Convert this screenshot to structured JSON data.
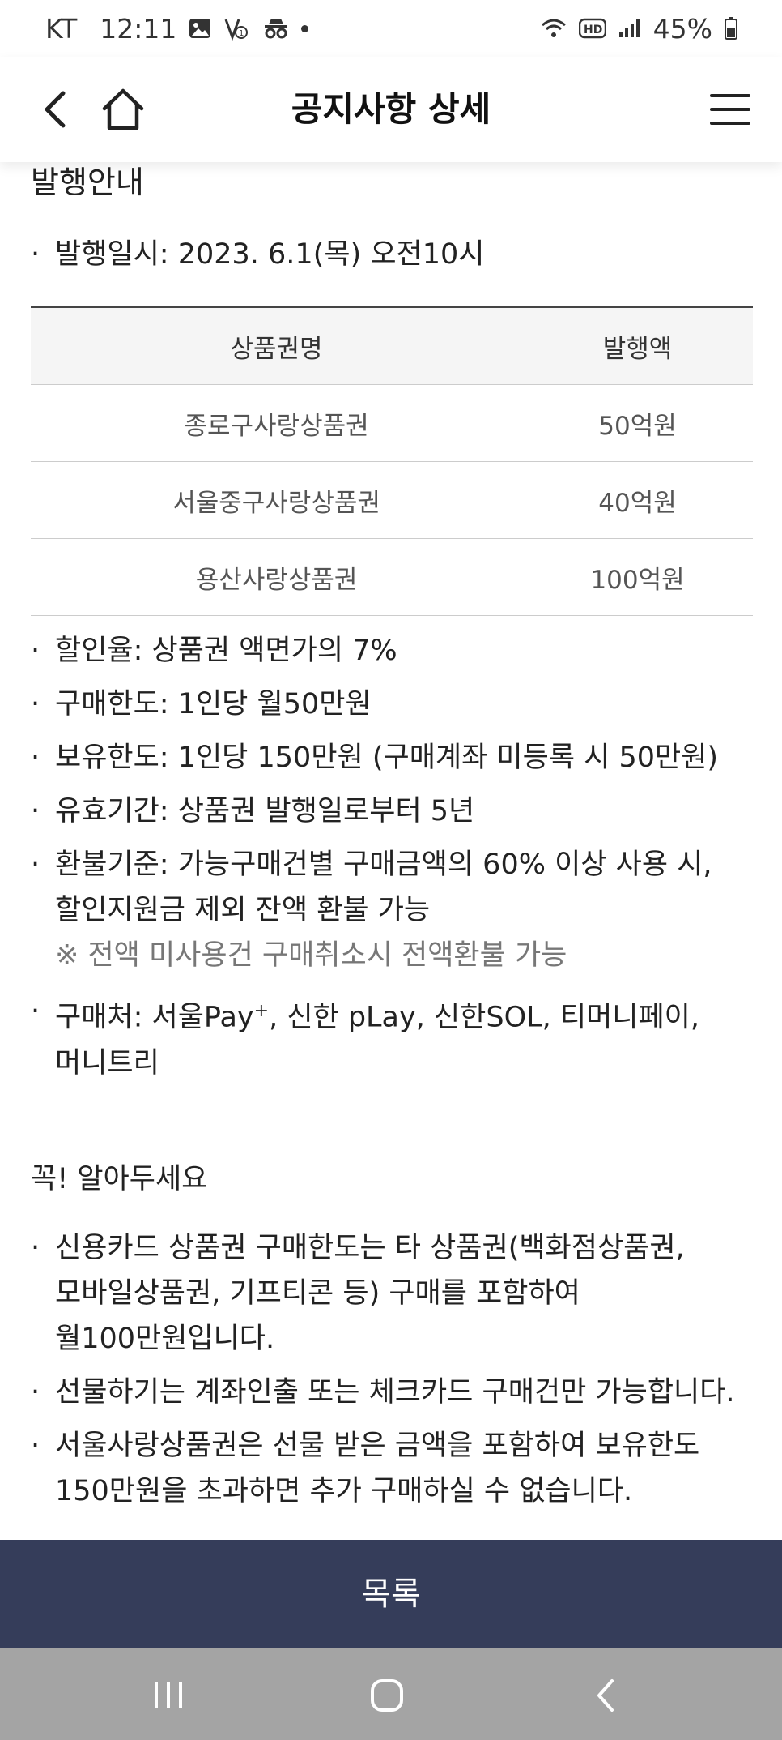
{
  "status": {
    "carrier": "KT",
    "time": "12:11",
    "battery": "45%"
  },
  "header": {
    "title": "공지사항 상세"
  },
  "section1": {
    "title": "발행안내",
    "date_line": "발행일시: 2023. 6.1(목) 오전10시"
  },
  "table": {
    "headers": [
      "상품권명",
      "발행액"
    ],
    "rows": [
      [
        "종로구사랑상품권",
        "50억원"
      ],
      [
        "서울중구사랑상품권",
        "40억원"
      ],
      [
        "용산사랑상품권",
        "100억원"
      ]
    ]
  },
  "bullets": {
    "b1": "할인율: 상품권 액면가의 7%",
    "b2": "구매한도: 1인당 월50만원",
    "b3": "보유한도: 1인당 150만원 (구매계좌 미등록 시 50만원)",
    "b4": "유효기간: 상품권 발행일로부터 5년",
    "b5_line1": "환불기준: 가능구매건별 구매금액의 60% 이상 사용 시,",
    "b5_line2": "할인지원금 제외 잔액 환불 가능",
    "b5_note": "※ 전액 미사용건 구매취소시 전액환불 가능",
    "b6_prefix": "구매처: 서울Pay",
    "b6_sup": "+",
    "b6_rest": ", 신한 pLay, 신한SOL, 티머니페이,",
    "b6_line2": "머니트리"
  },
  "section2": {
    "title": "꼭! 알아두세요",
    "n1_line1": "신용카드 상품권 구매한도는 타 상품권(백화점상품권,",
    "n1_line2": "모바일상품권, 기프티콘 등) 구매를 포함하여",
    "n1_line3": "월100만원입니다.",
    "n2": "선물하기는 계좌인출 또는 체크카드 구매건만 가능합니다.",
    "n3_line1": "서울사랑상품권은 선물 받은 금액을 포함하여 보유한도",
    "n3_line2": "150만원을 초과하면 추가 구매하실 수 없습니다."
  },
  "footer": {
    "list_button": "목록"
  }
}
